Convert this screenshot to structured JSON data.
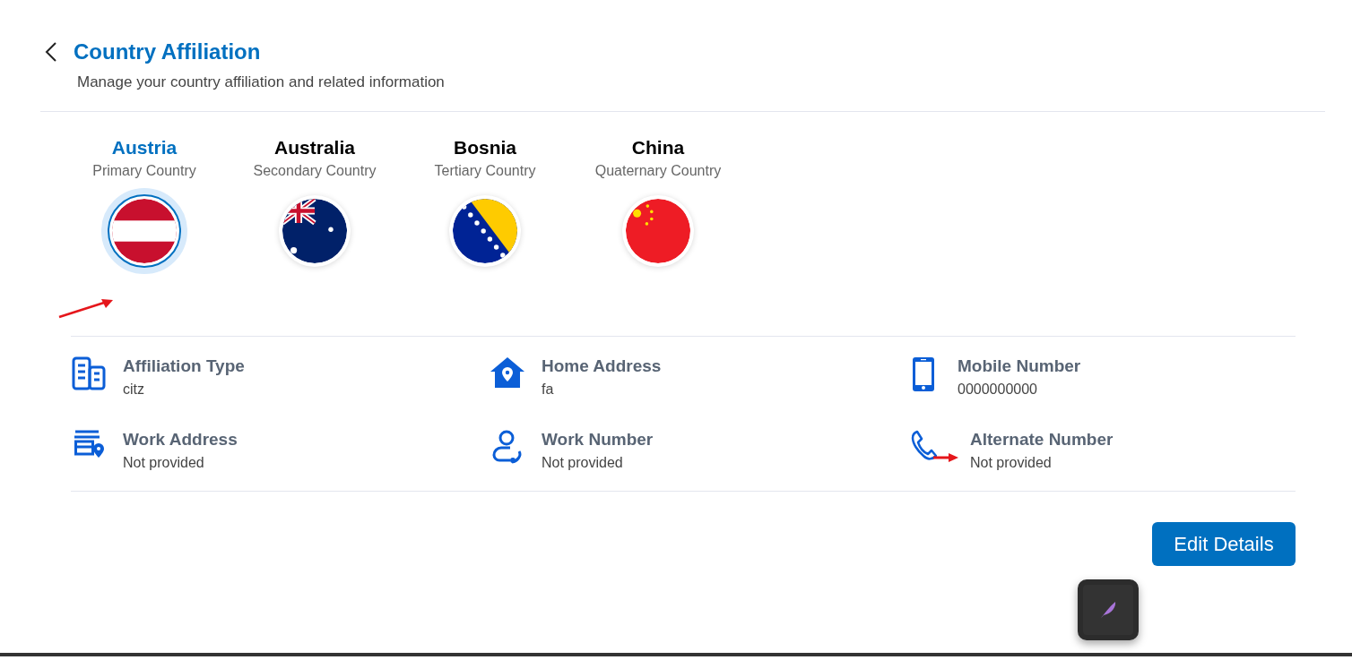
{
  "header": {
    "title": "Country Affiliation",
    "subtitle": "Manage your country affiliation and related information"
  },
  "countries": [
    {
      "name": "Austria",
      "role": "Primary Country",
      "selected": true
    },
    {
      "name": "Australia",
      "role": "Secondary Country",
      "selected": false
    },
    {
      "name": "Bosnia",
      "role": "Tertiary Country",
      "selected": false
    },
    {
      "name": "China",
      "role": "Quaternary Country",
      "selected": false
    }
  ],
  "details": [
    {
      "label": "Affiliation Type",
      "value": "citz"
    },
    {
      "label": "Home Address",
      "value": "fa"
    },
    {
      "label": "Mobile Number",
      "value": "0000000000"
    },
    {
      "label": "Work Address",
      "value": "Not provided"
    },
    {
      "label": "Work Number",
      "value": "Not provided"
    },
    {
      "label": "Alternate Number",
      "value": "Not provided"
    }
  ],
  "edit_button": "Edit Details"
}
